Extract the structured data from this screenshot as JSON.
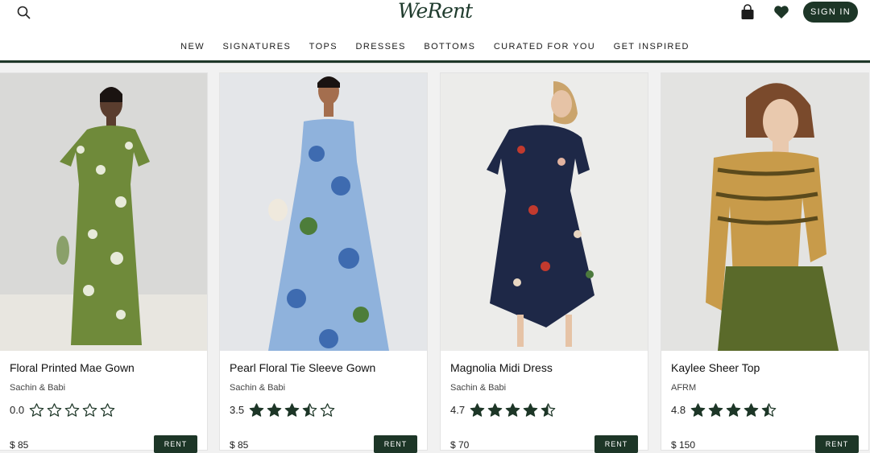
{
  "header": {
    "logo": "WeRent",
    "signin_label": "SIGN IN",
    "icons": [
      "search-icon",
      "bag-icon",
      "heart-icon"
    ]
  },
  "nav": {
    "items": [
      "NEW",
      "SIGNATURES",
      "TOPS",
      "DRESSES",
      "BOTTOMS",
      "CURATED FOR YOU",
      "GET INSPIRED"
    ]
  },
  "colors": {
    "brand": "#1d3627",
    "star": "#1d3627"
  },
  "products": [
    {
      "title": "Floral Printed Mae Gown",
      "brand": "Sachin & Babi",
      "rating": "0.0",
      "stars": 0,
      "price": "$ 85",
      "rent_label": "RENT"
    },
    {
      "title": "Pearl Floral Tie Sleeve Gown",
      "brand": "Sachin & Babi",
      "rating": "3.5",
      "stars": 3.5,
      "price": "$ 85",
      "rent_label": "RENT"
    },
    {
      "title": "Magnolia Midi Dress",
      "brand": "Sachin & Babi",
      "rating": "4.7",
      "stars": 4.5,
      "price": "$ 70",
      "rent_label": "RENT"
    },
    {
      "title": "Kaylee Sheer Top",
      "brand": "AFRM",
      "rating": "4.8",
      "stars": 4.5,
      "price": "$ 150",
      "rent_label": "RENT"
    }
  ]
}
